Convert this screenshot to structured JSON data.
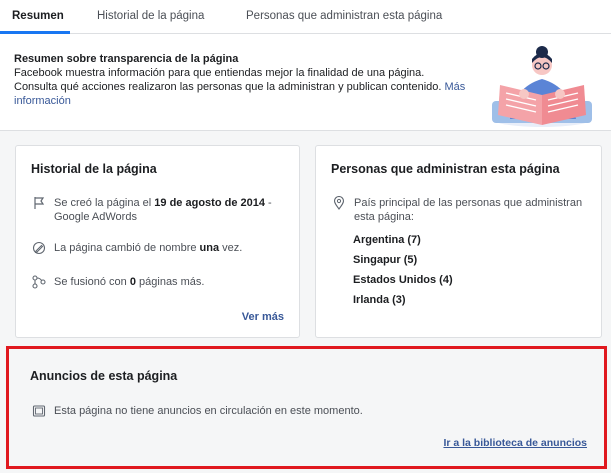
{
  "tabs": [
    {
      "label": "Resumen",
      "active": true
    },
    {
      "label": "Historial de la página",
      "active": false
    },
    {
      "label": "Personas que administran esta página",
      "active": false
    }
  ],
  "summary": {
    "title": "Resumen sobre transparencia de la página",
    "line1": "Facebook muestra información para que entiendas mejor la finalidad de una página.",
    "line2": "Consulta qué acciones realizaron las personas que la administran y publican contenido. ",
    "more_link": "Más información"
  },
  "history_card": {
    "title": "Historial de la página",
    "created_pre": "Se creó la página el ",
    "created_date": "19 de agosto de 2014",
    "created_post": " - Google AdWords",
    "renamed_pre": "La página cambió de nombre ",
    "renamed_count": "una",
    "renamed_post": " vez.",
    "merged_pre": "Se fusionó con ",
    "merged_count": "0",
    "merged_post": " páginas más.",
    "see_more": "Ver más"
  },
  "admins_card": {
    "title": "Personas que administran esta página",
    "country_label": "País principal de las personas que administran esta página:",
    "countries": [
      "Argentina (7)",
      "Singapur (5)",
      "Estados Unidos (4)",
      "Irlanda (3)"
    ]
  },
  "ads_card": {
    "title": "Anuncios de esta página",
    "message": "Esta página no tiene anuncios en circulación en este momento.",
    "library_link": "Ir a la biblioteca de anuncios"
  },
  "colors": {
    "accent": "#1877f2",
    "link": "#385898",
    "highlight_border": "#e0191f",
    "background": "#f5f6f7"
  }
}
